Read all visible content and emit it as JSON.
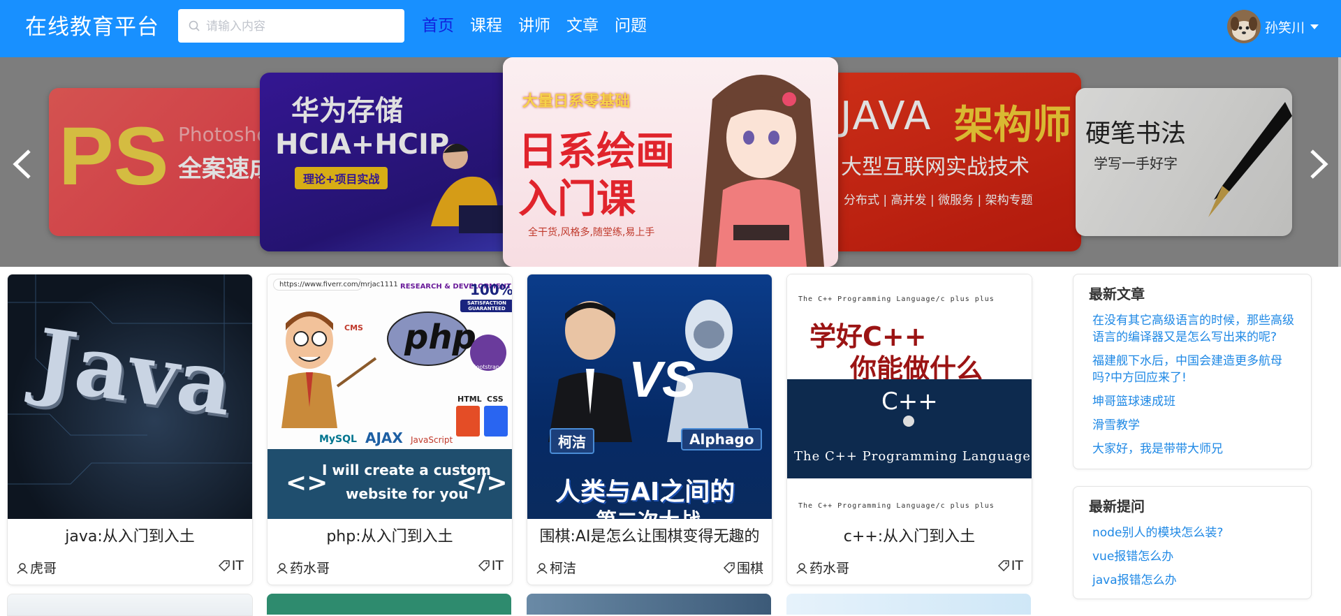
{
  "header": {
    "logo": "在线教育平台",
    "search_placeholder": "请输入内容",
    "nav": [
      "首页",
      "课程",
      "讲师",
      "文章",
      "问题"
    ],
    "active_nav": "首页",
    "user_name": "孙笑川"
  },
  "banner": {
    "slides": [
      {
        "big": "PS",
        "sub": "Photosho",
        "line": "全案速成"
      },
      {
        "line1": "华为存储",
        "line2": "HCIA+HCIP",
        "badge": "理论+项目实战"
      },
      {
        "top": "大量日系零基础",
        "line1": "日系绘画",
        "line2": "入门课",
        "bottom": "全干货,风格多,随堂练,易上手"
      },
      {
        "line1": "JAVA",
        "line2": "架构师",
        "line3": "大型互联网实战技术",
        "line4": "分布式 | 高并发 | 微服务 | 架构专题"
      },
      {
        "line1": "硬笔书法",
        "line2": "学写一手好字"
      }
    ]
  },
  "courses": [
    {
      "title": "java:从入门到入土",
      "author": "虎哥",
      "tag": "IT",
      "thumb_text": "Java"
    },
    {
      "title": "php:从入门到入土",
      "author": "药水哥",
      "tag": "IT",
      "thumb_text": "php",
      "url_text": "https://www.fiverr.com/mrjac1111",
      "bottom_text1": "I will create a custom",
      "bottom_text2": "website for you",
      "labels": [
        "RESEARCH & DEVELOPMENT",
        "100%",
        "SATISFACTION GUARANTEED",
        "CMS",
        "MySQL",
        "AJAX",
        "JavaScript",
        "HTML",
        "CSS",
        "Bootstrap 3"
      ]
    },
    {
      "title": "围棋:AI是怎么让围棋变得无趣的",
      "author": "柯洁",
      "tag": "围棋",
      "thumb_text1": "柯洁",
      "thumb_text2": "Alphago",
      "thumb_text3": "人类与AI之间的",
      "thumb_text4": "第二次大战"
    },
    {
      "title": "c++:从入门到入土",
      "author": "药水哥",
      "tag": "IT",
      "top_small": "The C++ Programming Language/c plus plus",
      "thumb_text1": "学好C++",
      "thumb_text2": "你能做什么",
      "thumb_text3": "C++",
      "thumb_text4": "The C++ Programming Language"
    }
  ],
  "latest_articles": {
    "title": "最新文章",
    "items": [
      "在没有其它高级语言的时候，那些高级语言的编译器又是怎么写出来的呢?",
      "福建舰下水后，中国会建造更多航母吗?中方回应来了!",
      "坤哥篮球速成班",
      "滑雪教学",
      "大家好，我是带带大师兄"
    ]
  },
  "latest_questions": {
    "title": "最新提问",
    "items": [
      "node别人的模块怎么装?",
      "vue报错怎么办",
      "java报错怎么办"
    ]
  },
  "colors": {
    "header": "#1890ff",
    "link": "#1e88e5",
    "active_nav": "#1122dd"
  }
}
